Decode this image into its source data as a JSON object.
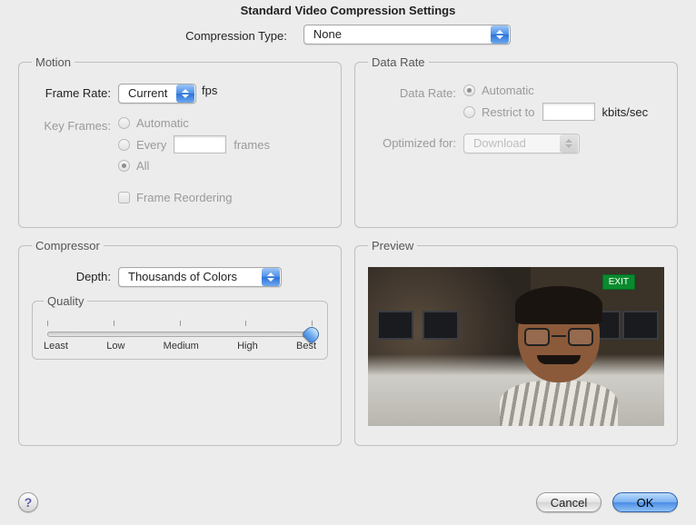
{
  "title": "Standard Video Compression Settings",
  "top": {
    "label": "Compression Type:",
    "value": "None"
  },
  "motion": {
    "legend": "Motion",
    "frame_rate_label": "Frame Rate:",
    "frame_rate_value": "Current",
    "fps_unit": "fps",
    "key_frames_label": "Key Frames:",
    "kf_auto": "Automatic",
    "kf_every": "Every",
    "kf_every_unit": "frames",
    "kf_all": "All",
    "kf_selected": "all",
    "frame_reorder": "Frame Reordering"
  },
  "data_rate": {
    "legend": "Data Rate",
    "label": "Data Rate:",
    "auto": "Automatic",
    "restrict": "Restrict to",
    "restrict_unit": "kbits/sec",
    "selected": "automatic",
    "optimized_label": "Optimized for:",
    "optimized_value": "Download"
  },
  "compressor": {
    "legend": "Compressor",
    "depth_label": "Depth:",
    "depth_value": "Thousands of Colors",
    "quality_legend": "Quality",
    "slider_labels": [
      "Least",
      "Low",
      "Medium",
      "High",
      "Best"
    ],
    "slider_value_index": 4
  },
  "preview": {
    "legend": "Preview",
    "exit_sign": "EXIT"
  },
  "footer": {
    "help": "?",
    "cancel": "Cancel",
    "ok": "OK"
  }
}
